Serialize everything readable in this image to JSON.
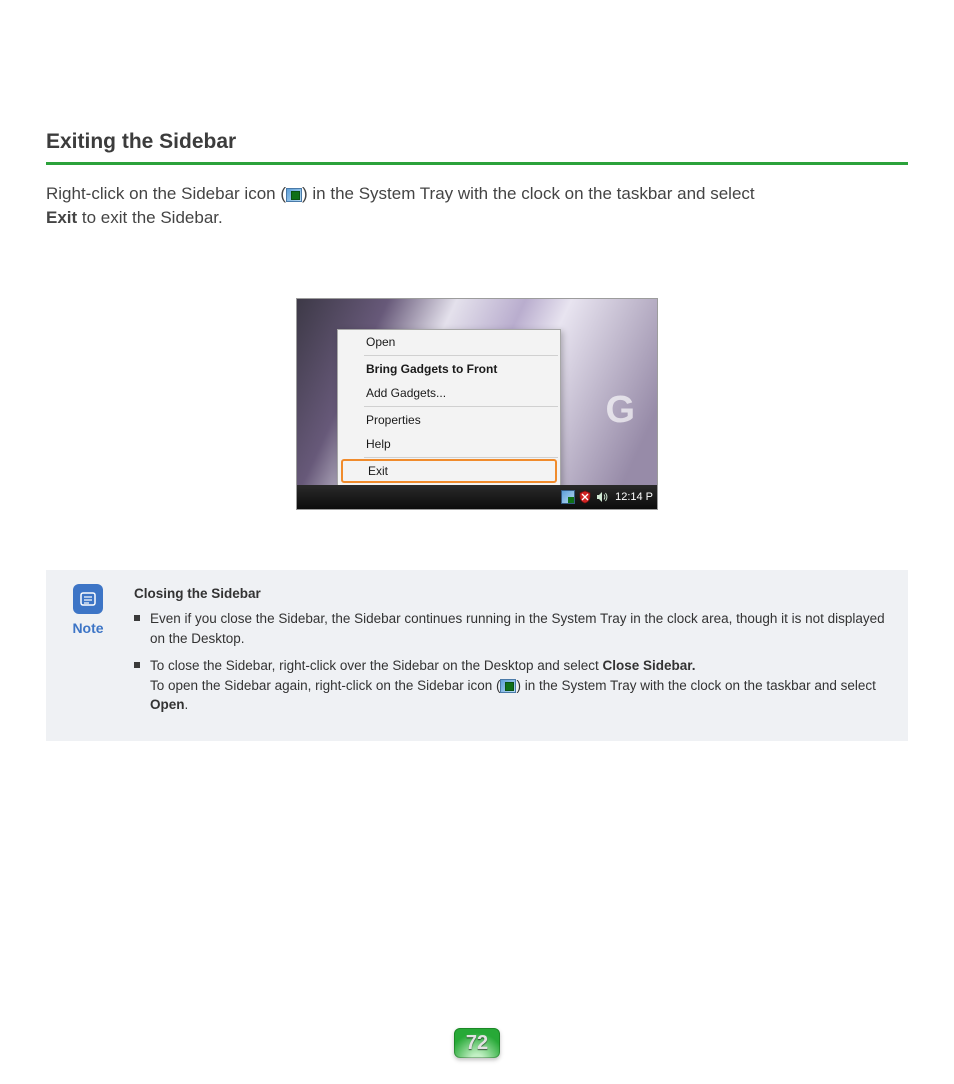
{
  "section_title": "Exiting the Sidebar",
  "intro": {
    "part1": "Right-click on the Sidebar icon (",
    "part2": ") in the System Tray with the clock on the taskbar and select ",
    "bold_exit": "Exit",
    "part3": " to exit the Sidebar."
  },
  "context_menu": {
    "open": "Open",
    "bring_front": "Bring Gadgets to Front",
    "add_gadgets": "Add Gadgets...",
    "properties": "Properties",
    "help": "Help",
    "exit": "Exit"
  },
  "bg_letter": "G",
  "taskbar": {
    "clock": "12:14 P"
  },
  "note": {
    "label": "Note",
    "title": "Closing the Sidebar",
    "bullet1": "Even if you close the Sidebar, the Sidebar continues running in the System Tray in the clock area, though it is not displayed on the Desktop.",
    "bullet2_a": "To close the Sidebar, right-click over the Sidebar on the Desktop and select ",
    "bullet2_bold": "Close Sidebar.",
    "bullet2_b": "To open the Sidebar again, right-click on the Sidebar icon (",
    "bullet2_c": ") in the System Tray with the clock on the taskbar and select ",
    "bullet2_open_bold": "Open",
    "bullet2_d": "."
  },
  "page_number": "72"
}
